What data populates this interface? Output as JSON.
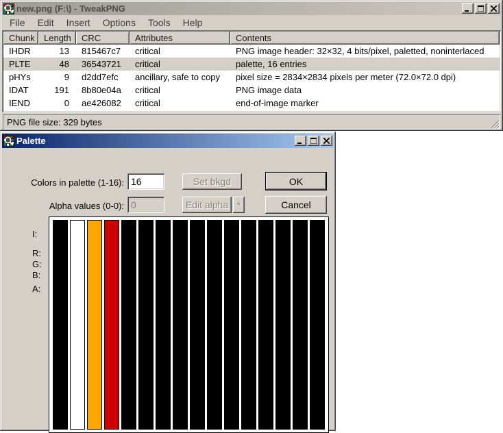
{
  "main_window": {
    "title": "new.png (F:\\) - TweakPNG",
    "menu": [
      "File",
      "Edit",
      "Insert",
      "Options",
      "Tools",
      "Help"
    ],
    "columns": [
      "Chunk",
      "Length",
      "CRC",
      "Attributes",
      "Contents"
    ],
    "rows": [
      {
        "chunk": "IHDR",
        "length": "13",
        "crc": "815467c7",
        "attributes": "critical",
        "contents": "PNG image header: 32×32, 4 bits/pixel, paletted, noninterlaced",
        "selected": false
      },
      {
        "chunk": "PLTE",
        "length": "48",
        "crc": "36543721",
        "attributes": "critical",
        "contents": "palette, 16 entries",
        "selected": true
      },
      {
        "chunk": "pHYs",
        "length": "9",
        "crc": "d2dd7efc",
        "attributes": "ancillary, safe to copy",
        "contents": "pixel size = 2834×2834 pixels per meter (72.0×72.0 dpi)",
        "selected": false
      },
      {
        "chunk": "IDAT",
        "length": "191",
        "crc": "8b80e04a",
        "attributes": "critical",
        "contents": "PNG image data",
        "selected": false
      },
      {
        "chunk": "IEND",
        "length": "0",
        "crc": "ae426082",
        "attributes": "critical",
        "contents": "end-of-image marker",
        "selected": false
      }
    ],
    "status": "PNG file size: 329 bytes"
  },
  "palette_dialog": {
    "title": "Palette",
    "colors_label": "Colors in palette (1-16):",
    "colors_value": "16",
    "set_bkgd_label": "Set bkgd",
    "ok_label": "OK",
    "alpha_label": "Alpha values (0-0):",
    "alpha_value": "0",
    "edit_alpha_label": "Edit alpha",
    "asterisk_label": "*",
    "cancel_label": "Cancel",
    "channel_labels": [
      "I:",
      "R:",
      "G:",
      "B:",
      "A:"
    ],
    "swatches": [
      "#000000",
      "#FFFFFF",
      "#FFA500",
      "#CC0000",
      "#000000",
      "#000000",
      "#000000",
      "#000000",
      "#000000",
      "#000000",
      "#000000",
      "#000000",
      "#000000",
      "#000000",
      "#000000",
      "#000000"
    ]
  },
  "colors": {
    "window_face": "#D4D0C8",
    "active_title_start": "#0A246A",
    "active_title_end": "#A6CAF0",
    "inactive_title_start": "#9E9C94",
    "inactive_title_end": "#CDC9C1",
    "selection_inactive": "#D4D0C8",
    "palette_orange": "#FFA500",
    "palette_red": "#CC0000"
  }
}
